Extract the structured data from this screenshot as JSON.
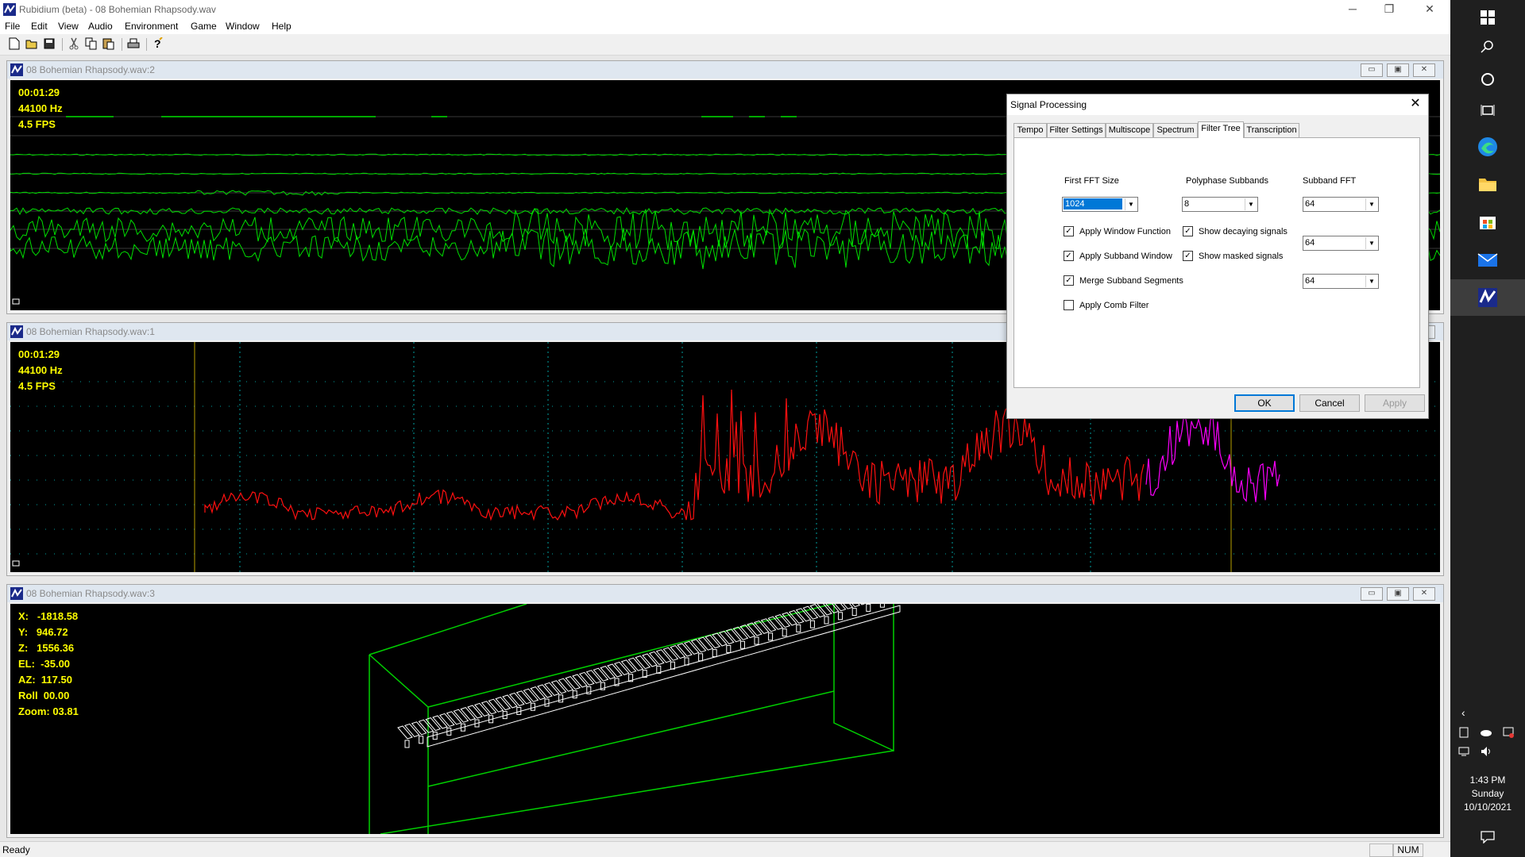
{
  "app": {
    "title": "Rubidium (beta) - 08 Bohemian Rhapsody.wav",
    "window_controls": {
      "minimize": "─",
      "restore": "❐",
      "close": "✕"
    }
  },
  "menu": [
    "File",
    "Edit",
    "View",
    "Audio",
    "Environment",
    "Game",
    "Window",
    "Help"
  ],
  "toolbar": {
    "buttons": [
      "new-file-icon",
      "open-folder-icon",
      "save-icon",
      "cut-icon",
      "copy-icon",
      "paste-icon",
      "print-icon",
      "help-icon"
    ]
  },
  "windows": {
    "spectrogram": {
      "title": "08 Bohemian Rhapsody.wav:2",
      "time": "00:01:29",
      "rate": "44100 Hz",
      "fps": "4.5 FPS"
    },
    "spectrum": {
      "title": "08 Bohemian Rhapsody.wav:1",
      "time": "00:01:29",
      "rate": "44100 Hz",
      "fps": "4.5 FPS"
    },
    "piano3d": {
      "title": "08 Bohemian Rhapsody.wav:3",
      "x": "X:   -1818.58",
      "y": "Y:   946.72",
      "z": "Z:   1556.36",
      "el": "EL:  -35.00",
      "az": "AZ:  117.50",
      "roll": "Roll  00.00",
      "zoom": "Zoom: 03.81"
    },
    "child_controls": {
      "minimize": "▭",
      "maximize": "▣",
      "close": "✕"
    }
  },
  "dialog": {
    "title": "Signal Processing",
    "close": "✕",
    "tabs": [
      "Tempo",
      "Filter Settings",
      "Multiscope",
      "Spectrum",
      "Filter Tree",
      "Transcription"
    ],
    "active_tab": "Filter Tree",
    "labels": {
      "first_fft": "First FFT Size",
      "polyphase": "Polyphase Subbands",
      "subband_fft": "Subband FFT"
    },
    "values": {
      "first_fft": "1024",
      "polyphase": "8",
      "subband_fft_1": "64",
      "subband_fft_2": "64",
      "subband_fft_3": "64"
    },
    "checkboxes": {
      "apply_window_function": {
        "label": "Apply Window Function",
        "checked": true
      },
      "apply_subband_window": {
        "label": "Apply Subband Window",
        "checked": true
      },
      "merge_subband_segments": {
        "label": "Merge Subband Segments",
        "checked": true
      },
      "apply_comb_filter": {
        "label": "Apply Comb Filter",
        "checked": false
      },
      "show_decaying_signals": {
        "label": "Show decaying signals",
        "checked": true
      },
      "show_masked_signals": {
        "label": "Show masked signals",
        "checked": true
      }
    },
    "buttons": {
      "ok": "OK",
      "cancel": "Cancel",
      "apply": "Apply"
    }
  },
  "statusbar": {
    "text": "Ready",
    "num": "NUM"
  },
  "taskbar": {
    "icons": [
      "windows-start-icon",
      "search-icon",
      "cortana-icon",
      "task-view-icon",
      "edge-browser-icon",
      "file-explorer-icon",
      "store-icon",
      "mail-icon",
      "rubidium-app-icon"
    ],
    "clock": {
      "time": "1:43 PM",
      "day": "Sunday",
      "date": "10/10/2021"
    }
  },
  "colors": {
    "spectrogram_trace": "#00e000",
    "spectrum_trace": "#ff1010",
    "spectrum_highlight": "#ff00ff",
    "overlay_text": "#ffff00",
    "wireframe": "#00d000",
    "grid_dots": "#00a0a0"
  }
}
